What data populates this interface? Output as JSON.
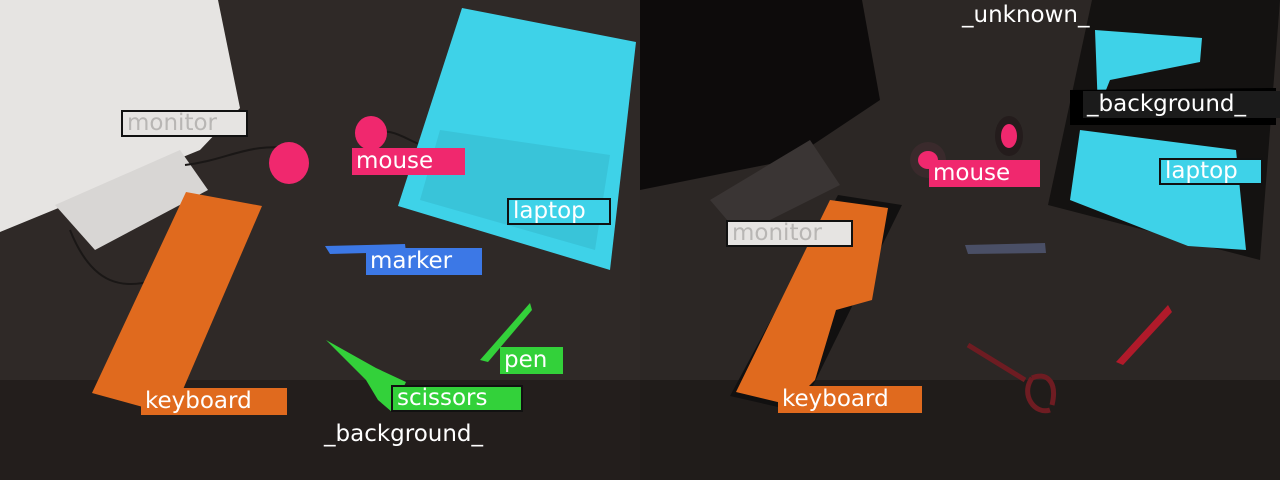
{
  "left_panel": {
    "labels": {
      "monitor": "monitor",
      "mouse": "mouse",
      "laptop": "laptop",
      "marker": "marker",
      "keyboard": "keyboard",
      "scissors": "scissors",
      "pen": "pen",
      "background": "_background_"
    }
  },
  "right_panel": {
    "labels": {
      "unknown": "_unknown_",
      "background": "_background_",
      "mouse": "mouse",
      "laptop": "laptop",
      "monitor": "monitor",
      "keyboard": "keyboard"
    }
  },
  "colors": {
    "monitor": "#e6e4e2",
    "mouse": "#f0286e",
    "laptop": "#3ed2e8",
    "marker": "#3c78e6",
    "keyboard": "#e06a1e",
    "scissors": "#33d13a",
    "pen": "#33d13a",
    "desk": "#2f2927"
  }
}
